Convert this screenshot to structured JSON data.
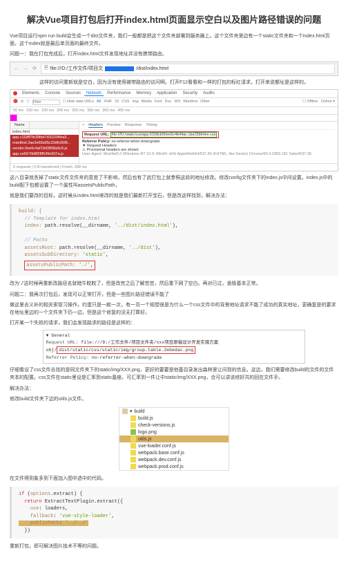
{
  "title": "解决Vue项目打包后打开index.html页面显示空白以及图片路径错误的问题",
  "intro": "Vue项目运行npm run build会生成一个dist文件夹，我们一般都是把这个文件夹部署到服务器上。这个文件夹里边有一个static文件夹和一个index.html页面，这个index就是最后单页面的最终文件。",
  "problem1_label": "问题一：",
  "problem1_text": "我在打包完成后，打开index.html文件发现地址并没有携带路由。",
  "url_prefix": "file:///D:/工作文件/项目文",
  "url_suffix": "/dist/index.html",
  "note1": "这样的访问重新就是空白，因为没有使用被带路由的访问啊。打开F12看看和一样的打包的标红请求，打开来说都址是这样的。",
  "devtools": {
    "tabs": [
      "Elements",
      "Console",
      "Sources",
      "Network",
      "Performance",
      "Memory",
      "Application",
      "Security",
      "Audits"
    ],
    "filter_opts": [
      "Filter",
      "Hide data URLs",
      "All",
      "XHR",
      "JS",
      "CSS",
      "Img",
      "Media",
      "Font",
      "Doc",
      "WS",
      "Manifest",
      "Other"
    ],
    "timeline": [
      "50 ms",
      "100 ms",
      "150 ms",
      "200 ms",
      "250 ms",
      "300 ms",
      "350 ms",
      "400 ms"
    ],
    "list_cols": [
      "Name"
    ],
    "items": [
      {
        "name": "index.html",
        "type": "html"
      },
      {
        "name": "app.c118ff7fe39feb7d31104fea3...",
        "type": "err"
      },
      {
        "name": "manifest.2ae2e69a05c33dfc65f8...",
        "type": "err"
      },
      {
        "name": "vendor.0ee6c4af19d3858a9c6.js",
        "type": "err"
      },
      {
        "name": "app.ce6676b8f28f549e507a.js",
        "type": "err"
      }
    ],
    "panel_tabs": [
      "Headers",
      "Preview",
      "Response",
      "Timing"
    ],
    "request_url_label": "Request URL:",
    "request_url": "file:///D:/static/css/app.6158cb50ee5c4b44ac.cba15bfcfee.css",
    "ref_label": "Referrer Policy:",
    "ref_val": "no-referrer-when-downgrade",
    "req_headers": "▼ Request Headers",
    "prov": "⚠ Provisional headers are shown",
    "ua": "User-Agent: Mozilla/5.0 (Windows NT 10.0; Win64; x64) AppleWebKit/537.36 (KHTML, like Gecko) Chrome/66.0.3359.181 Safari/537.36"
  },
  "unit_stats": "5 requests | 0 B transferred | Finish: 308 ms",
  "para2": "这八目录就丢掉了static文件文件夹的意思了不影响，然后也有了武打包上就参照这段的地址修改。修改config文件夹下的index.js中间设置。index.js中的build配下包都设置了一个属性叫assetsPublicPath，",
  "para3": "就是我们要改的目标，这时候从index.html来改的就是我们最新打开宝石，但是改这样找到，解决办法：",
  "code1_build": "build: {",
  "code1_comment1": "// Template for index.html",
  "code1_index": "index: path.resolve(__dirname, '../dist/index.html'),",
  "code1_comment2": "// Paths",
  "code1_root": "assetsRoot: path.resolve(__dirname, '../dist'),",
  "code1_sub": "assetsSubDirectory: 'static',",
  "code1_pub": "assetsPublicPath: './',",
  "para4": "改为'./'这时候再重新改路径名就暗牛眈眈了，但是改完之后了解苦苦，然后重下网了空白。再对已过，诡极基本正常。",
  "para5": "问题二：我再次打包后，发现可以正常打开，但是一些图片路径错误不能了",
  "para6": "做这里去义补的相关索管习操作，约蛋只是一款一次，有一页一个规想很是为什么一个css文件中的背景地址请求不能了成功的真实地址，更确复是的要求在地址里边的一个文件夹下仍一边，但是这个修复的没无打算好。",
  "para7": "打开某一个失败的请求，我们会发现路求的路径是这样的：",
  "general": {
    "heading": "▼ General",
    "url_label": "Request URL:",
    "url_pre": "file:///D:/工作文件/项目文件夹/xxx项目原稿设计开发实施方案",
    "url_obj": "dist/static/css/static/img/group-table.2ebedac.png",
    "ref_label": "Referrer Policy:",
    "ref": "no-referrer-when-downgrade"
  },
  "para8": "仔细看设了css文件去找的是同文件夹下的static/img/XXX.png，更好的要要是他基目录发出森林里让问到的信息。这边，我们需要修改build的文件的文件夹本的配置。css文件在static里设是汇率到static基座。可汇率到一件让中static/img/XXX.png，合可以讲该修好共的回在文件手。",
  "para9": "解决办法：",
  "para10": "修改build文件夹下边的utils.js文件。",
  "tree": {
    "root": "build",
    "items": [
      {
        "name": "build.js",
        "icon": "js"
      },
      {
        "name": "check-versions.js",
        "icon": "js"
      },
      {
        "name": "logo.png",
        "icon": "png"
      },
      {
        "name": "utils.js",
        "icon": "js",
        "hl": true
      },
      {
        "name": "vue-loader.conf.js",
        "icon": "js"
      },
      {
        "name": "webpack.base.conf.js",
        "icon": "js"
      },
      {
        "name": "webpack.dev.conf.js",
        "icon": "js"
      },
      {
        "name": "webpack.prod.conf.js",
        "icon": "js"
      }
    ]
  },
  "para11": "在文件得到象多到下面加入图中选中的代码。",
  "code2_if": "if (options.extract) {",
  "code2_ret": "  return ExtractTextPlugin.extract({",
  "code2_use": "    use: loaders,",
  "code2_fall": "    fallback: 'vue-style-loader',",
  "code2_pub": "    publicPath: '../../'",
  "code2_close": "  })",
  "para12": "重新打包，即可解决图片技术不等的问题。"
}
